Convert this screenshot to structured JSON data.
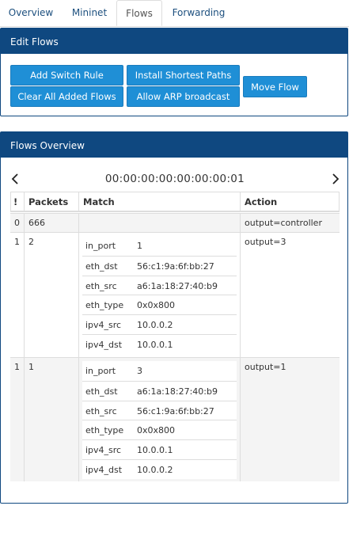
{
  "tabs": [
    {
      "label": "Overview"
    },
    {
      "label": "Mininet"
    },
    {
      "label": "Flows",
      "active": true
    },
    {
      "label": "Forwarding"
    }
  ],
  "edit_flows": {
    "title": "Edit Flows",
    "buttons": {
      "add_switch_rule": "Add Switch Rule",
      "clear_all": "Clear All Added Flows",
      "install_shortest": "Install Shortest Paths",
      "allow_arp": "Allow ARP broadcast",
      "move_flow": "Move Flow"
    }
  },
  "flows_overview": {
    "title": "Flows Overview",
    "device_id": "00:00:00:00:00:00:00:01",
    "columns": [
      "!",
      "Packets",
      "Match",
      "Action"
    ],
    "rows": [
      {
        "priority": "0",
        "packets": "666",
        "match": [],
        "action": "output=controller"
      },
      {
        "priority": "1",
        "packets": "2",
        "action": "output=3",
        "match": [
          {
            "key": "in_port",
            "value": "1"
          },
          {
            "key": "eth_dst",
            "value": "56:c1:9a:6f:bb:27"
          },
          {
            "key": "eth_src",
            "value": "a6:1a:18:27:40:b9"
          },
          {
            "key": "eth_type",
            "value": "0x0x800"
          },
          {
            "key": "ipv4_src",
            "value": "10.0.0.2"
          },
          {
            "key": "ipv4_dst",
            "value": "10.0.0.1"
          }
        ]
      },
      {
        "priority": "1",
        "packets": "1",
        "action": "output=1",
        "match": [
          {
            "key": "in_port",
            "value": "3"
          },
          {
            "key": "eth_dst",
            "value": "a6:1a:18:27:40:b9"
          },
          {
            "key": "eth_src",
            "value": "56:c1:9a:6f:bb:27"
          },
          {
            "key": "eth_type",
            "value": "0x0x800"
          },
          {
            "key": "ipv4_src",
            "value": "10.0.0.1"
          },
          {
            "key": "ipv4_dst",
            "value": "10.0.0.2"
          }
        ]
      }
    ]
  },
  "colors": {
    "primary": "#0f4880",
    "button": "#1f8fd6",
    "stripe": "#f4f4f4"
  }
}
